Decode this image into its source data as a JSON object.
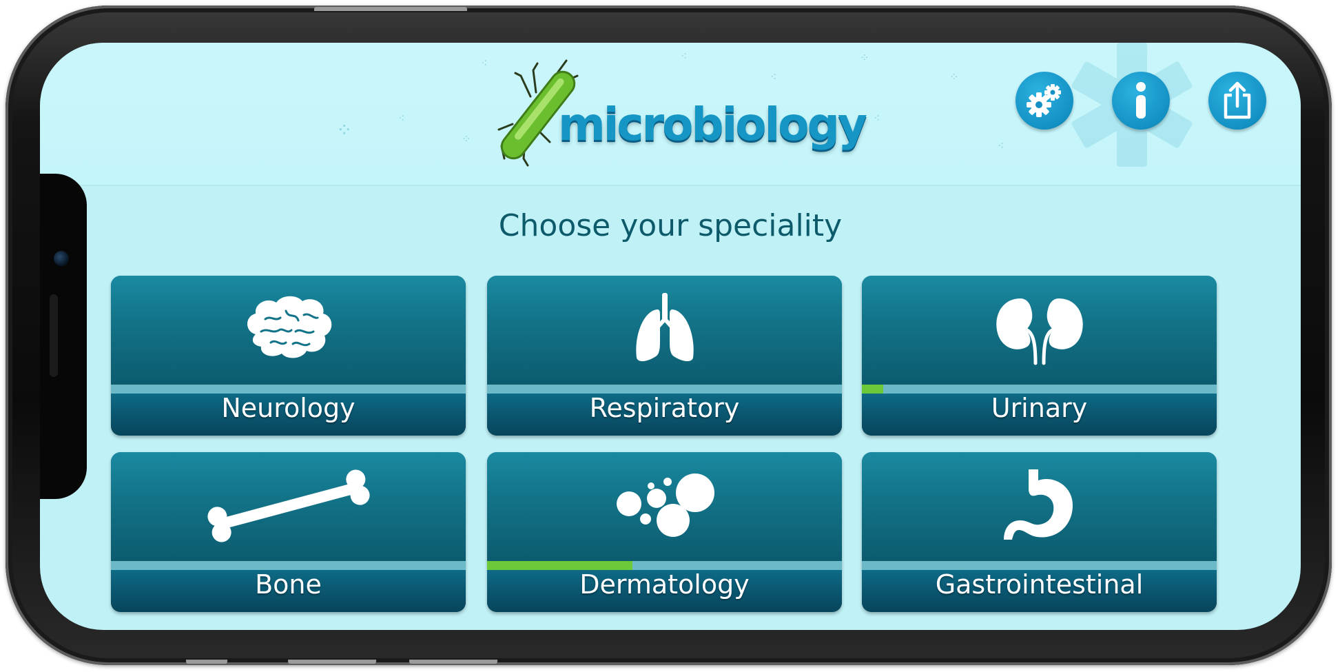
{
  "app": {
    "name": "microbiology",
    "title": "Choose your speciality"
  },
  "header": {
    "buttons": [
      {
        "id": "settings",
        "icon": "gears-icon"
      },
      {
        "id": "info",
        "icon": "info-icon"
      },
      {
        "id": "share",
        "icon": "share-icon"
      }
    ]
  },
  "specialities": [
    {
      "label": "Neurology",
      "icon": "brain-icon",
      "progress": 0
    },
    {
      "label": "Respiratory",
      "icon": "lungs-icon",
      "progress": 0
    },
    {
      "label": "Urinary",
      "icon": "kidneys-icon",
      "progress": 0.06
    },
    {
      "label": "Bone",
      "icon": "bone-icon",
      "progress": 0
    },
    {
      "label": "Dermatology",
      "icon": "cells-icon",
      "progress": 0.41
    },
    {
      "label": "Gastrointestinal",
      "icon": "stomach-icon",
      "progress": 0
    }
  ],
  "colors": {
    "background": "#bff1f7",
    "tile": "#0f6a80",
    "progress_fill": "#6cc93a",
    "accent": "#1491c4",
    "title_text": "#0d5a6b"
  }
}
